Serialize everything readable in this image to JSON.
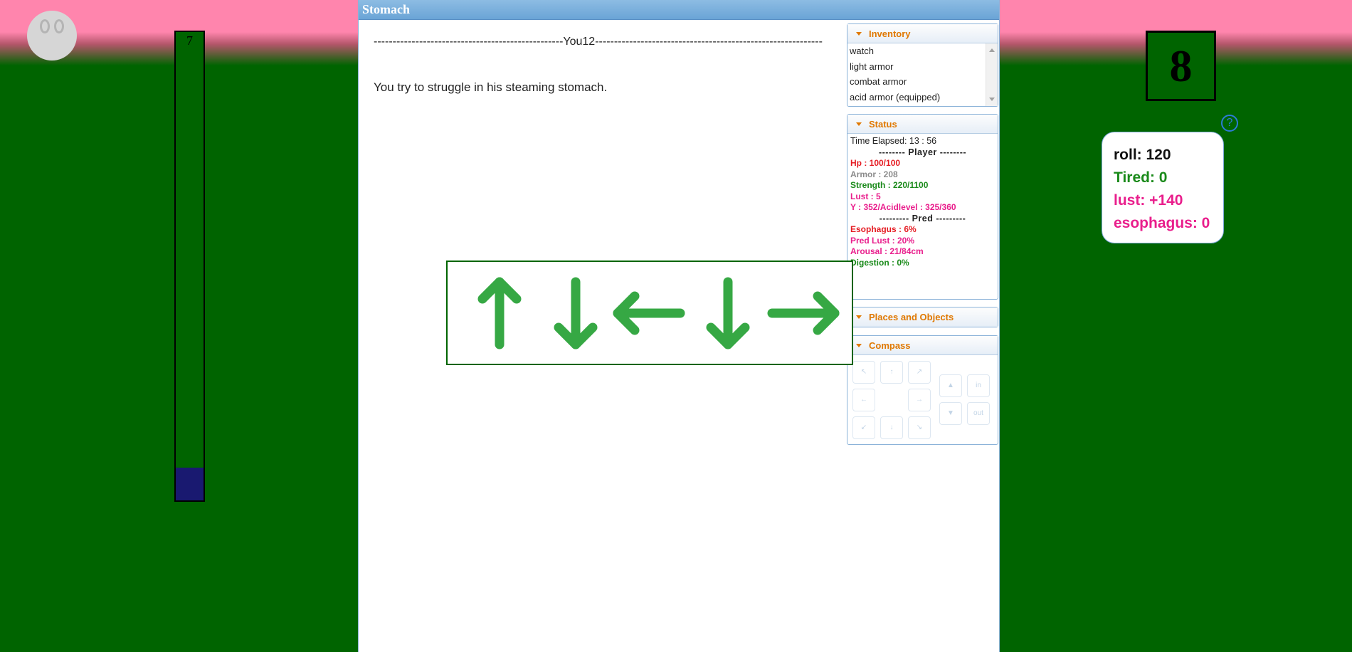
{
  "left_gauge": {
    "number": "7",
    "fill_fraction": 0.07
  },
  "main": {
    "title": "Stomach",
    "divider": "--------------------------------------------------You12------------------------------------------------------------",
    "story": "You try to struggle in his steaming stomach."
  },
  "inventory": {
    "title": "Inventory",
    "items": [
      "watch",
      "light armor",
      "combat armor",
      "acid armor (equipped)"
    ]
  },
  "status": {
    "title": "Status",
    "time": "Time Elapsed: 13 : 56",
    "player_sep": "--------  Player  --------",
    "hp": "Hp : 100/100",
    "armor": "Armor : 208",
    "strength": "Strength : 220/1100",
    "lust": "Lust : 5",
    "acid": "Y : 352/Acidlevel : 325/360",
    "pred_sep": "---------  Pred  ---------",
    "esophagus": "Esophagus : 6%",
    "pred_lust": "Pred Lust : 20%",
    "arousal": "Arousal : 21/84cm",
    "digestion": "Digestion : 0%"
  },
  "places": {
    "title": "Places and Objects"
  },
  "compass": {
    "title": "Compass",
    "nw": "↖",
    "n": "↑",
    "ne": "↗",
    "w": "←",
    "e": "→",
    "sw": "↙",
    "s": "↓",
    "se": "↘",
    "up": "▲",
    "down": "▼",
    "in": "in",
    "out": "out"
  },
  "arrows": {
    "sequence": [
      "up",
      "down",
      "left",
      "down",
      "right"
    ],
    "color": "#36a844"
  },
  "dice": {
    "value": "8"
  },
  "help": {
    "icon": "?"
  },
  "stats_card": {
    "roll": "roll: 120",
    "tired": "Tired: 0",
    "lust": "lust: +140",
    "esophagus": "esophagus: 0"
  },
  "colors": {
    "red": "#e51c23",
    "gray": "#8c8c8c",
    "green": "#1a8a1a",
    "pink": "#e91e8c",
    "orange": "#e07800"
  }
}
